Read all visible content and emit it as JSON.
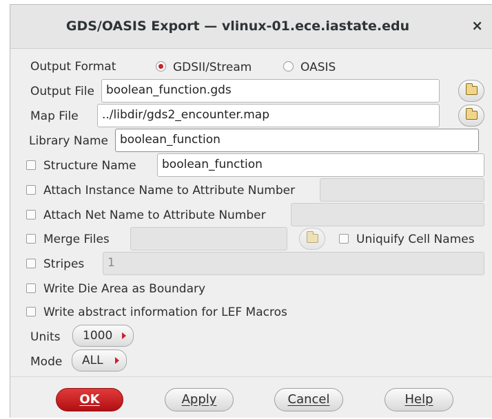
{
  "window": {
    "title": "GDS/OASIS Export — vlinux-01.ece.iastate.edu",
    "close": "×"
  },
  "output_format": {
    "label": "Output Format",
    "gdsii": "GDSII/Stream",
    "oasis": "OASIS",
    "selected": "GDSII/Stream"
  },
  "output_file": {
    "label": "Output File",
    "value": "boolean_function.gds"
  },
  "map_file": {
    "label": "Map File",
    "value": "../libdir/gds2_encounter.map"
  },
  "library_name": {
    "label": "Library Name",
    "value": "boolean_function"
  },
  "structure_name": {
    "label": "Structure Name",
    "value": "boolean_function",
    "checked": false
  },
  "attach_instance": {
    "label": "Attach Instance Name to Attribute Number",
    "value": "",
    "checked": false
  },
  "attach_net": {
    "label": "Attach Net Name to Attribute Number",
    "value": "",
    "checked": false
  },
  "merge_files": {
    "label": "Merge Files",
    "value": "",
    "checked": false
  },
  "uniquify": {
    "label": "Uniquify Cell Names",
    "checked": false
  },
  "stripes": {
    "label": "Stripes",
    "value": "1",
    "checked": false
  },
  "write_die_area": {
    "label": "Write Die Area as Boundary",
    "checked": false
  },
  "write_abstract": {
    "label": "Write abstract information for LEF Macros",
    "checked": false
  },
  "units": {
    "label": "Units",
    "value": "1000"
  },
  "mode": {
    "label": "Mode",
    "value": "ALL"
  },
  "buttons": {
    "ok": "OK",
    "apply": "Apply",
    "cancel": "Cancel",
    "help": "Help"
  },
  "colors": {
    "accent": "#c7222a",
    "background": "#efefef"
  },
  "icons": {
    "folder": "folder-open-icon",
    "dropdown": "menu-arrow-icon"
  }
}
